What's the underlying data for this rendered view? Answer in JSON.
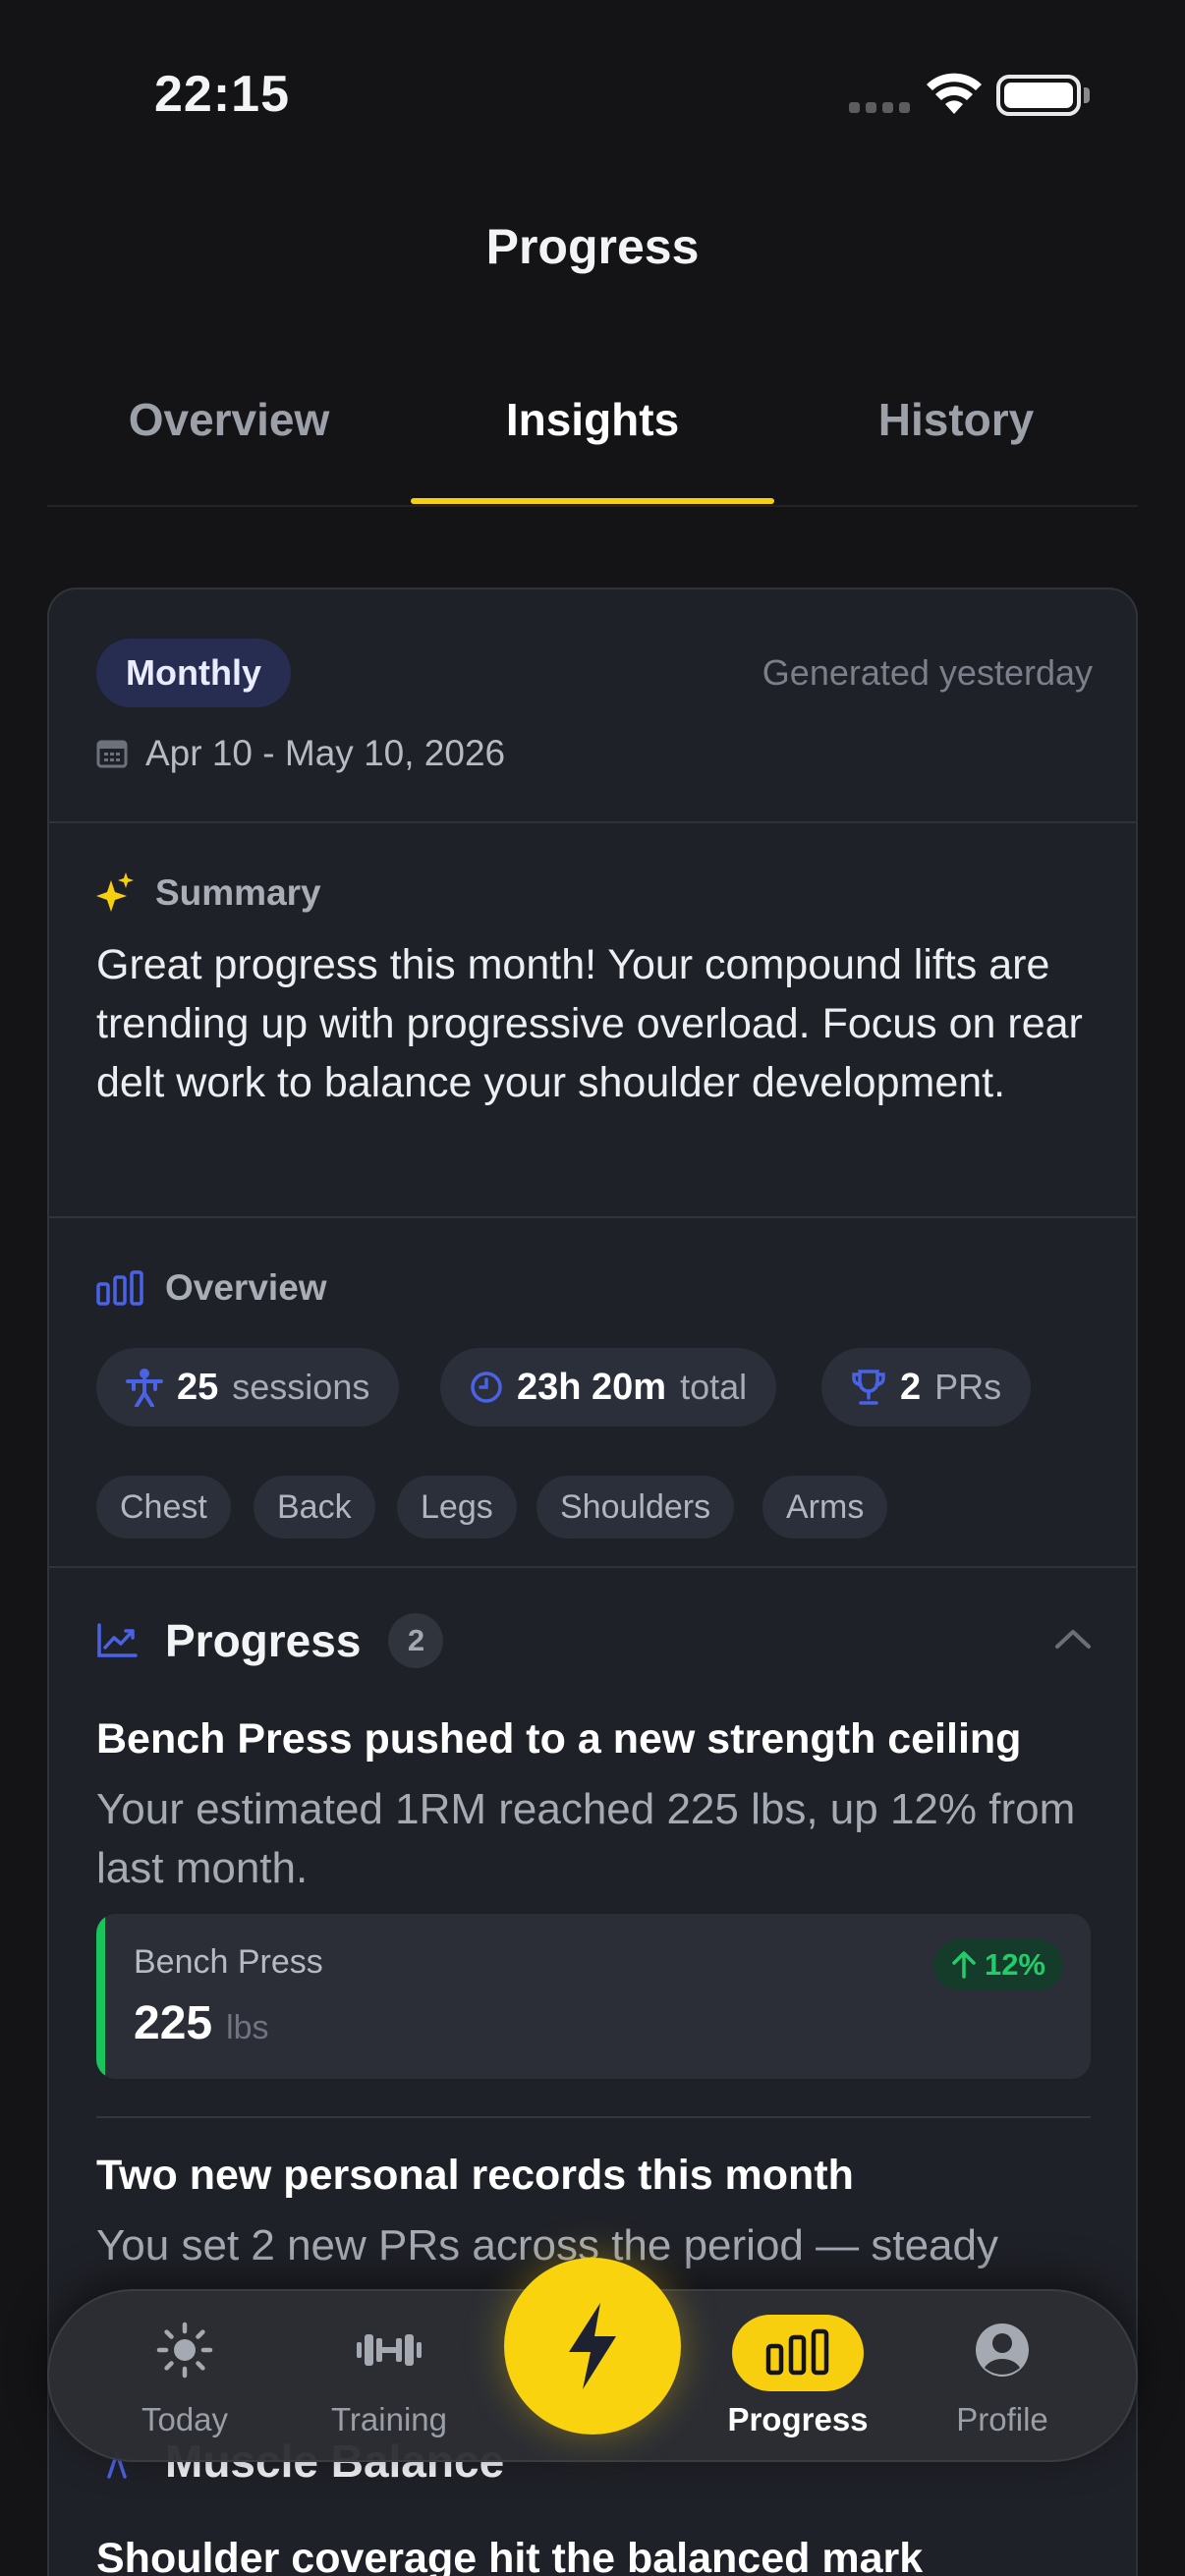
{
  "status_bar": {
    "time": "22:15"
  },
  "header": {
    "title": "Progress"
  },
  "tabs": [
    {
      "label": "Overview",
      "active": false
    },
    {
      "label": "Insights",
      "active": true
    },
    {
      "label": "History",
      "active": false
    }
  ],
  "report": {
    "period_badge": "Monthly",
    "generated": "Generated yesterday",
    "date_range": "Apr 10 - May 10, 2026",
    "summary": {
      "heading": "Summary",
      "text": "Great progress this month! Your compound lifts are trending up with progressive overload. Focus on rear delt work to balance your shoulder development."
    },
    "overview": {
      "heading": "Overview",
      "sessions": {
        "value": "25",
        "unit": "sessions"
      },
      "duration": {
        "value": "23h 20m",
        "unit": "total"
      },
      "prs": {
        "value": "2",
        "unit": "PRs"
      },
      "muscle_groups": [
        "Chest",
        "Back",
        "Legs",
        "Shoulders",
        "Arms"
      ]
    },
    "progress": {
      "heading": "Progress",
      "count": "2",
      "insights": [
        {
          "title": "Bench Press pushed to a new strength ceiling",
          "description": "Your estimated 1RM reached 225 lbs, up 12% from last month.",
          "metric": {
            "label": "Bench Press",
            "value": "225",
            "unit": "lbs",
            "change": "12%"
          }
        },
        {
          "title": "Two new personal records this month",
          "description": "You set 2 new PRs across the period — steady"
        }
      ]
    },
    "muscle_balance": {
      "heading": "Muscle Balance",
      "first_insight_title": "Shoulder coverage hit the balanced mark"
    }
  },
  "bottom_nav": {
    "items": [
      {
        "label": "Today",
        "icon": "sun-icon"
      },
      {
        "label": "Training",
        "icon": "dumbbell-icon"
      },
      {
        "label": "Progress",
        "icon": "bar-chart-icon",
        "active": true
      },
      {
        "label": "Profile",
        "icon": "user-circle-icon"
      }
    ],
    "fab_icon": "lightning-icon"
  },
  "colors": {
    "accent": "#f8cf0e",
    "positive": "#23cc6a",
    "icon_blue": "#4a62e6",
    "background": "#141416",
    "card": "#1f2128"
  }
}
